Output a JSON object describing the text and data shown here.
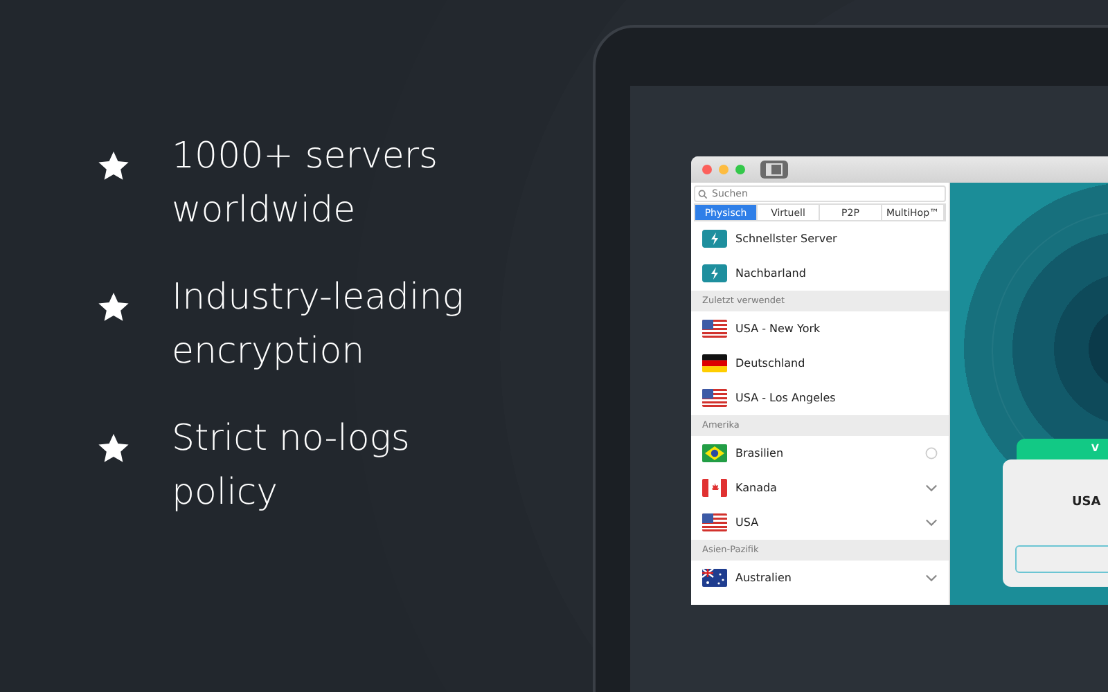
{
  "features": [
    {
      "text": "1000+ servers worldwide"
    },
    {
      "text": "Industry-leading encryption"
    },
    {
      "text": "Strict no-logs policy"
    }
  ],
  "app": {
    "search": {
      "placeholder": "Suchen"
    },
    "tabs": [
      {
        "label": "Physisch",
        "selected": true
      },
      {
        "label": "Virtuell",
        "selected": false
      },
      {
        "label": "P2P",
        "selected": false
      },
      {
        "label": "MultiHop™",
        "selected": false
      }
    ],
    "list": [
      {
        "kind": "server",
        "label": "Schnellster Server"
      },
      {
        "kind": "server",
        "label": "Nachbarland"
      },
      {
        "kind": "header",
        "label": "Zuletzt verwendet"
      },
      {
        "kind": "country",
        "label": "USA - New York"
      },
      {
        "kind": "country",
        "label": "Deutschland"
      },
      {
        "kind": "country",
        "label": "USA - Los Angeles"
      },
      {
        "kind": "header",
        "label": "Amerika"
      },
      {
        "kind": "choice",
        "label": "Brasilien",
        "selected": false
      },
      {
        "kind": "group",
        "label": "Kanada",
        "expanded": false
      },
      {
        "kind": "group",
        "label": "USA",
        "expanded": false
      },
      {
        "kind": "header",
        "label": "Asien-Pazifik"
      },
      {
        "kind": "group",
        "label": "Australien",
        "expanded": false
      }
    ],
    "status_badge": "V",
    "location_card": {
      "text": "USA"
    }
  }
}
